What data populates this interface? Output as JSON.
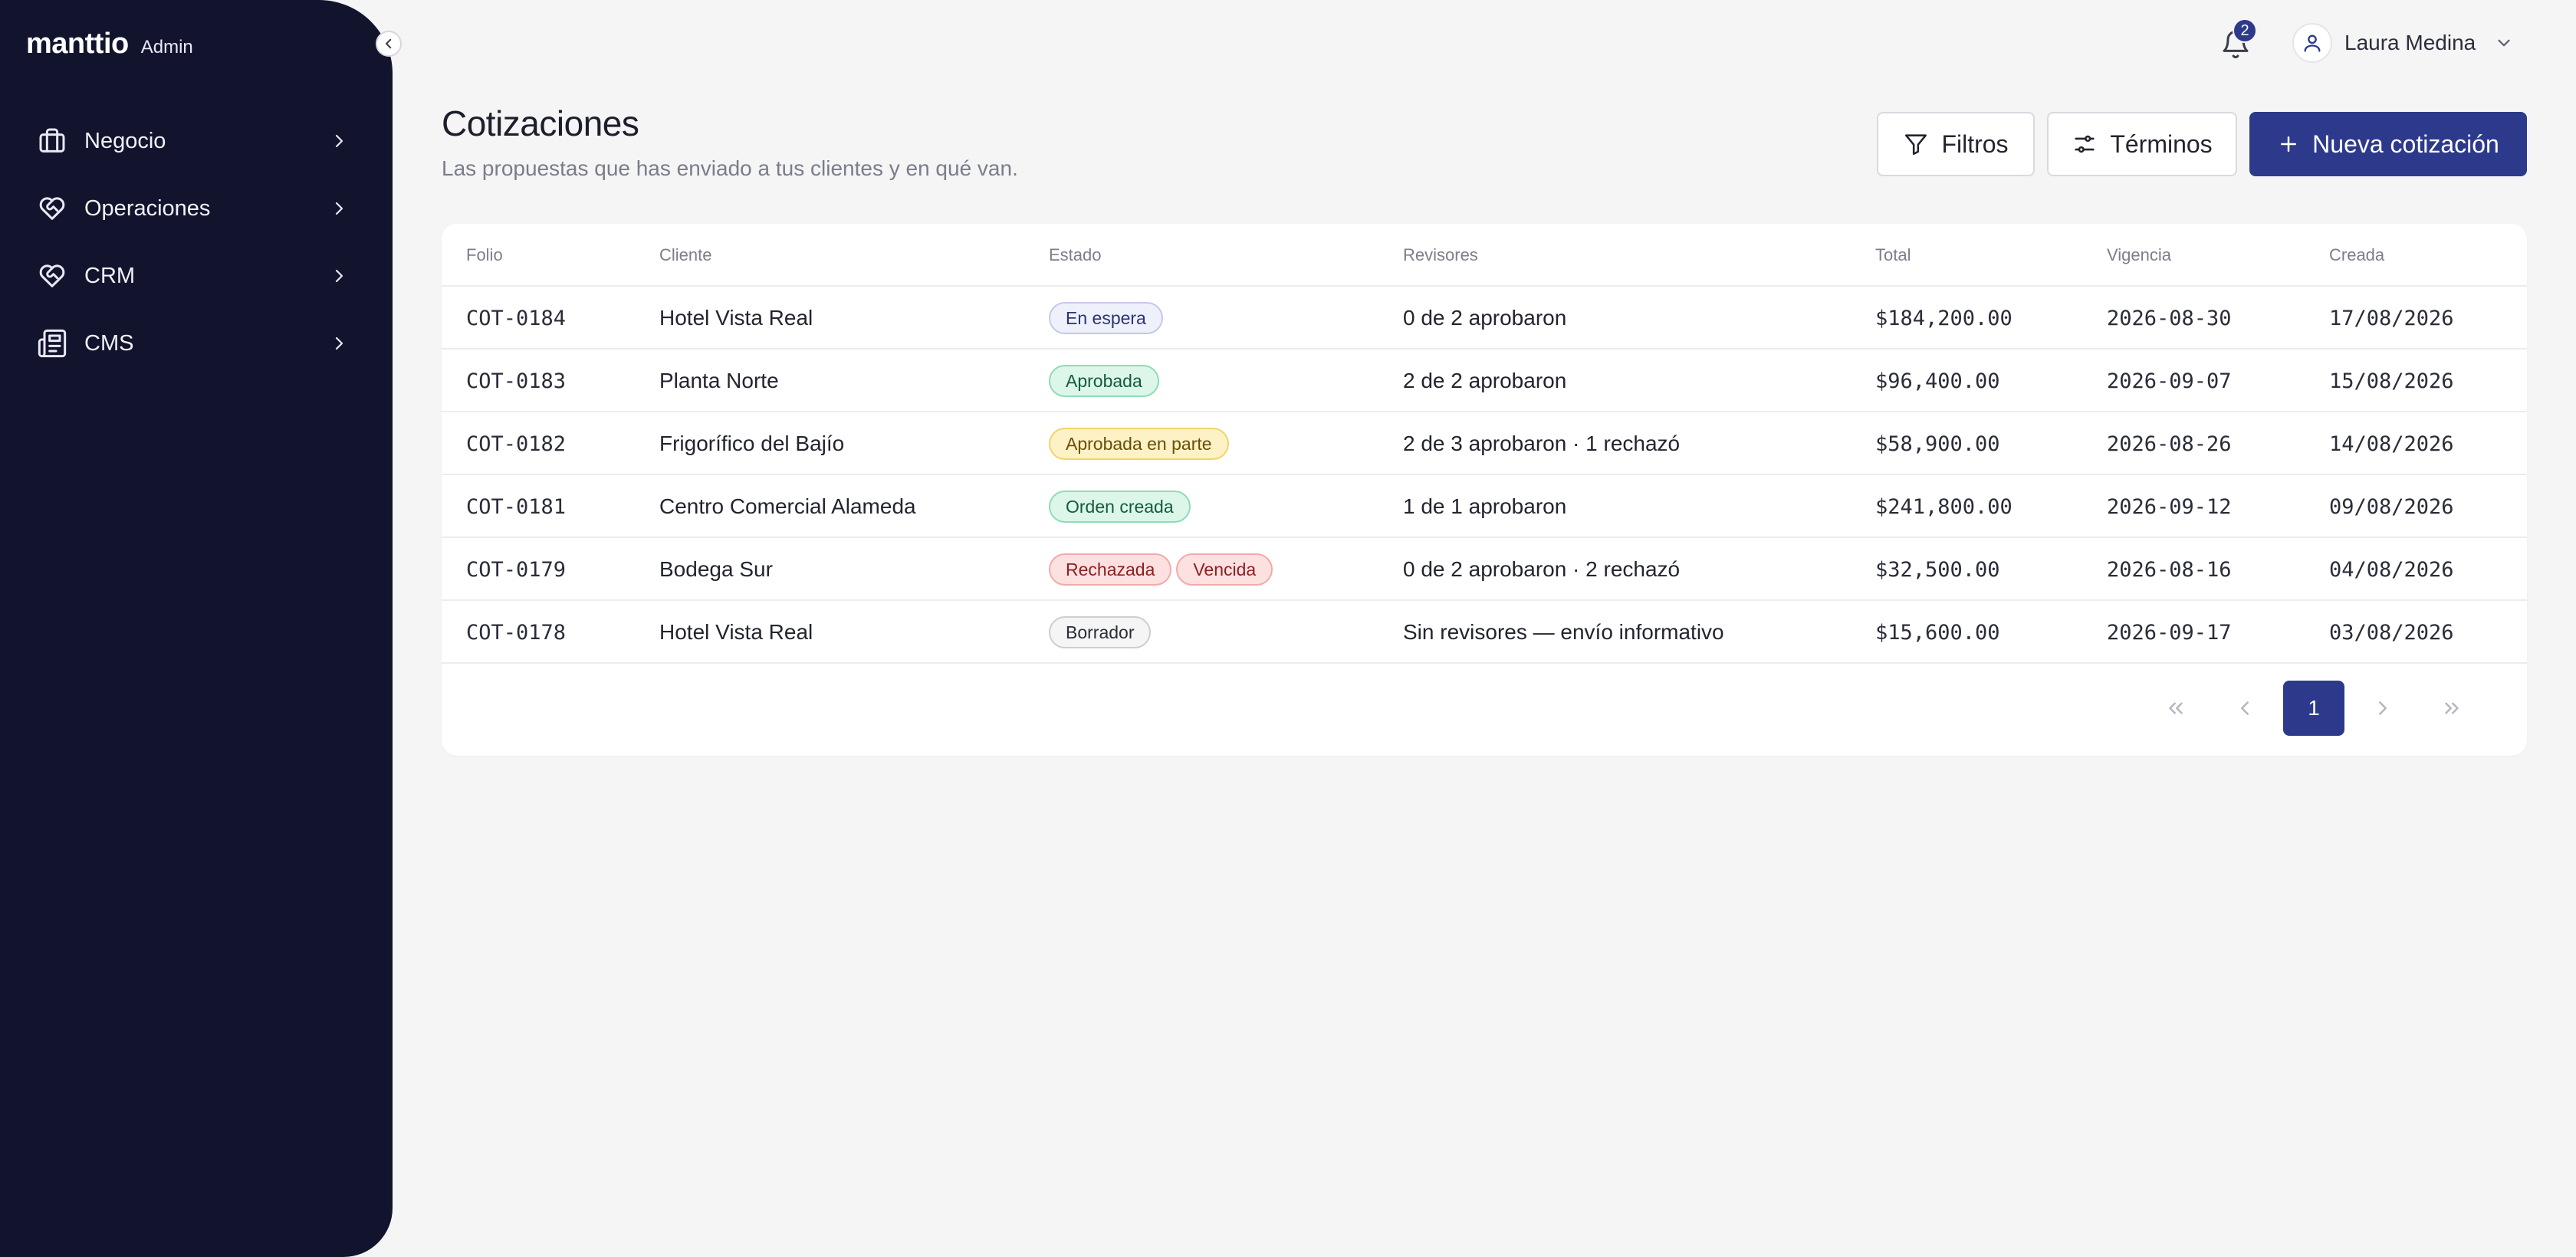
{
  "brand": {
    "name": "manttio",
    "tag": "Admin"
  },
  "sidebar": {
    "items": [
      {
        "label": "Negocio",
        "icon": "briefcase-icon"
      },
      {
        "label": "Operaciones",
        "icon": "heart-handshake-icon"
      },
      {
        "label": "CRM",
        "icon": "heart-handshake-icon"
      },
      {
        "label": "CMS",
        "icon": "newspaper-icon"
      }
    ]
  },
  "topbar": {
    "notifications_count": "2",
    "user_name": "Laura Medina"
  },
  "header": {
    "title": "Cotizaciones",
    "subtitle": "Las propuestas que has enviado a tus clientes y en qué van.",
    "filters_label": "Filtros",
    "terms_label": "Términos",
    "new_label": "Nueva cotización"
  },
  "table": {
    "columns": {
      "folio": "Folio",
      "cliente": "Cliente",
      "estado": "Estado",
      "revisores": "Revisores",
      "total": "Total",
      "vigencia": "Vigencia",
      "creada": "Creada"
    },
    "rows": [
      {
        "folio": "COT-0184",
        "cliente": "Hotel Vista Real",
        "estado": [
          "En espera"
        ],
        "revisores": "0 de 2 aprobaron",
        "total": "$184,200.00",
        "vigencia": "2026-08-30",
        "creada": "17/08/2026"
      },
      {
        "folio": "COT-0183",
        "cliente": "Planta Norte",
        "estado": [
          "Aprobada"
        ],
        "revisores": "2 de 2 aprobaron",
        "total": "$96,400.00",
        "vigencia": "2026-09-07",
        "creada": "15/08/2026"
      },
      {
        "folio": "COT-0182",
        "cliente": "Frigorífico del Bajío",
        "estado": [
          "Aprobada en parte"
        ],
        "revisores": "2 de 3 aprobaron · 1 rechazó",
        "total": "$58,900.00",
        "vigencia": "2026-08-26",
        "creada": "14/08/2026"
      },
      {
        "folio": "COT-0181",
        "cliente": "Centro Comercial Alameda",
        "estado": [
          "Orden creada"
        ],
        "revisores": "1 de 1 aprobaron",
        "total": "$241,800.00",
        "vigencia": "2026-09-12",
        "creada": "09/08/2026"
      },
      {
        "folio": "COT-0179",
        "cliente": "Bodega Sur",
        "estado": [
          "Rechazada",
          "Vencida"
        ],
        "revisores": "0 de 2 aprobaron · 2 rechazó",
        "total": "$32,500.00",
        "vigencia": "2026-08-16",
        "creada": "04/08/2026"
      },
      {
        "folio": "COT-0178",
        "cliente": "Hotel Vista Real",
        "estado": [
          "Borrador"
        ],
        "revisores": "Sin revisores — envío informativo",
        "total": "$15,600.00",
        "vigencia": "2026-09-17",
        "creada": "03/08/2026"
      }
    ]
  },
  "pagination": {
    "current": "1"
  },
  "colors": {
    "sidebar_bg": "#12142e",
    "primary": "#2d3a8c",
    "page_bg": "#f5f5f5"
  }
}
